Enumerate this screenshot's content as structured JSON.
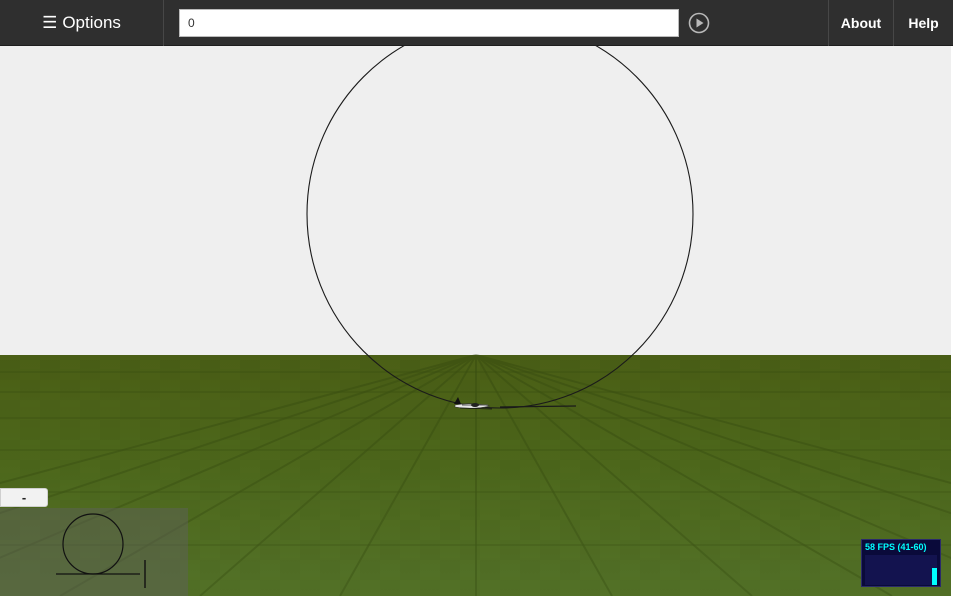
{
  "toolbar": {
    "options_icon": "menu-icon",
    "options_glyph": "☰",
    "options_label": "Options",
    "command_value": "0",
    "play_icon": "play-circle-icon",
    "about_label": "About",
    "help_label": "Help"
  },
  "minimap": {
    "collapse_label": "-"
  },
  "fps": {
    "label": "58 FPS (41-60)",
    "value": 58,
    "min": 41,
    "max": 60
  },
  "colors": {
    "toolbar_bg": "#2f2f2f",
    "sky": "#efefef",
    "ground": "#4f6a1c",
    "fps_text": "#00ffff",
    "fps_bg": "#0a0a3a"
  }
}
